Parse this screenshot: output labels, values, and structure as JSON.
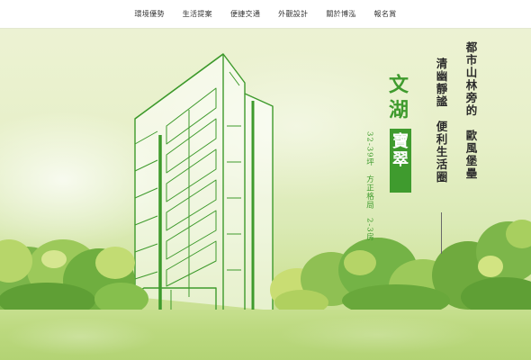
{
  "nav": {
    "items": [
      {
        "label": "環境優勢"
      },
      {
        "label": "生活提案"
      },
      {
        "label": "便捷交通"
      },
      {
        "label": "外觀設計"
      },
      {
        "label": "關於博泓"
      },
      {
        "label": "報名賞"
      }
    ]
  },
  "hero": {
    "tagline_line1": "都市山林旁的　歐風堡壘",
    "tagline_line2": "清幽靜謐　便利生活圈",
    "brand_line1": "文湖",
    "brand_line2": "寶翠",
    "spec": "32-39坪　方正格局　2-3房"
  },
  "colors": {
    "brand_green": "#3f9b2e",
    "text_dark": "#2b2b2b"
  }
}
